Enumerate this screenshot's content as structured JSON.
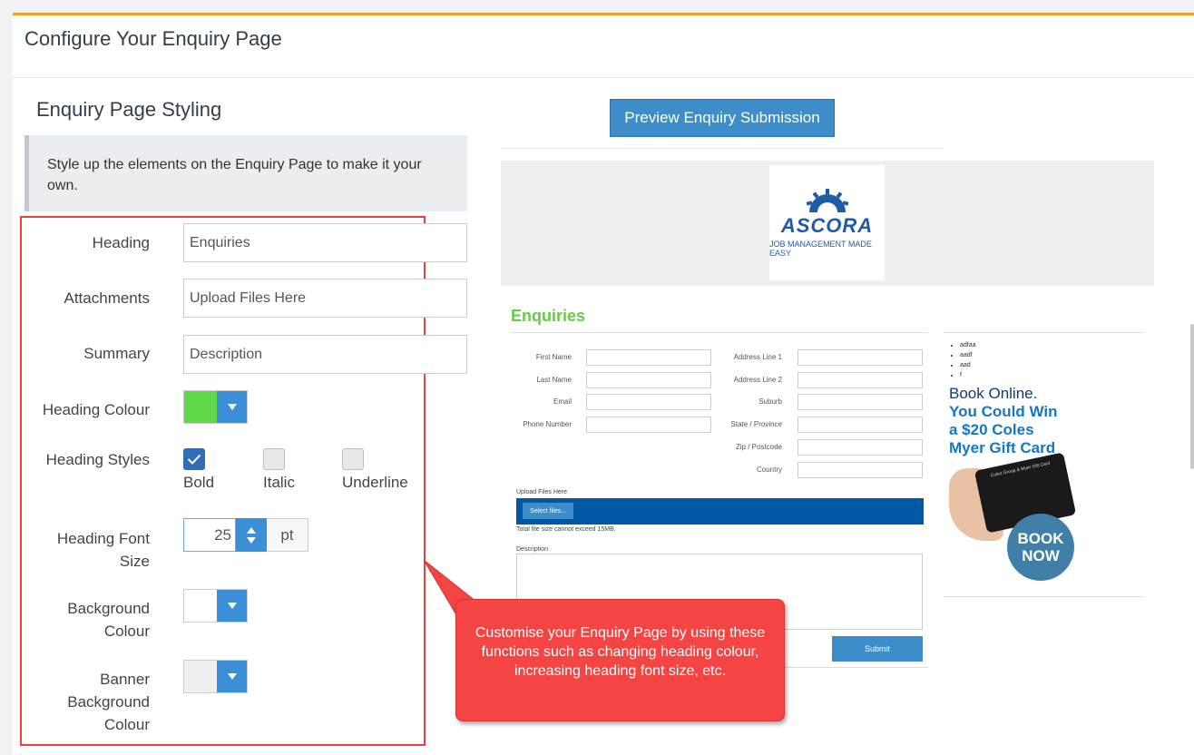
{
  "panel": {
    "title": "Configure Your Enquiry Page"
  },
  "styling": {
    "title": "Enquiry Page Styling",
    "note": "Style up the elements on the Enquiry Page to make it your own."
  },
  "form": {
    "heading": {
      "label": "Heading",
      "value": "Enquiries"
    },
    "attachments": {
      "label": "Attachments",
      "value": "Upload Files Here"
    },
    "summary": {
      "label": "Summary",
      "value": "Description"
    },
    "heading_colour": {
      "label": "Heading Colour",
      "color": "#5fd84a"
    },
    "heading_styles": {
      "label": "Heading Styles",
      "bold": {
        "label": "Bold",
        "checked": true
      },
      "italic": {
        "label": "Italic",
        "checked": false
      },
      "underline": {
        "label": "Underline",
        "checked": false
      }
    },
    "font_size": {
      "label_1": "Heading Font",
      "label_2": "Size",
      "value": "25",
      "unit": "pt"
    },
    "background_colour": {
      "label_1": "Background",
      "label_2": "Colour",
      "color": "#ffffff"
    },
    "banner_background_colour": {
      "label_1": "Banner",
      "label_2": "Background",
      "label_3": "Colour",
      "color": "#efefef"
    }
  },
  "preview": {
    "button_label": "Preview Enquiry Submission",
    "logo_word": "ASCORA",
    "logo_tagline": "JOB MANAGEMENT MADE EASY",
    "heading": "Enquiries",
    "fields_left": [
      "First Name",
      "Last Name",
      "Email",
      "Phone Number"
    ],
    "fields_right": [
      "Address Line 1",
      "Address Line 2",
      "Suburb",
      "State / Province",
      "Zip / Postcode",
      "Country"
    ],
    "upload_label": "Upload Files Here",
    "select_label": "Select files...",
    "upload_note": "Total file size cannot exceed 15MB.",
    "description_label": "Description",
    "submit_label": "Submit",
    "bullets": [
      "adfaa",
      "aadf",
      "aad",
      "f"
    ],
    "ad": {
      "line1": "Book Online.",
      "line2": "You Could Win",
      "line3": "a $20 Coles",
      "line4": "Myer Gift Card",
      "card_text": "Coles Group & Myer Gift Card",
      "book": "BOOK",
      "now": "NOW"
    }
  },
  "callout": {
    "text": "Customise your Enquiry Page by using these functions  such as changing heading colour, increasing heading font size, etc."
  }
}
